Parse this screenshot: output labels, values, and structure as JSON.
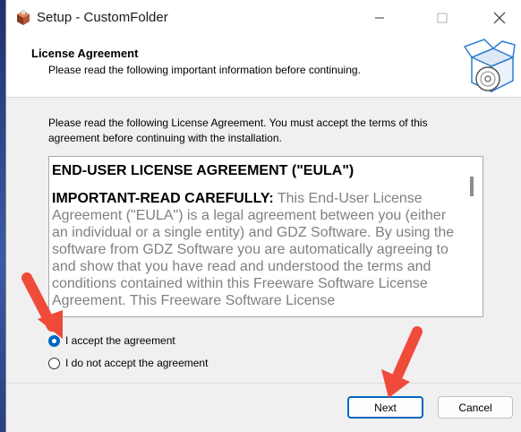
{
  "window": {
    "title": "Setup - CustomFolder"
  },
  "header": {
    "title": "License Agreement",
    "subtitle": "Please read the following important information before continuing."
  },
  "intro": "Please read the following License Agreement. You must accept the terms of this agreement before continuing with the installation.",
  "license": {
    "heading": "END-USER LICENSE AGREEMENT (\"EULA\")",
    "lead": "IMPORTANT-READ CAREFULLY:",
    "body": "This End-User License Agreement (\"EULA\") is a legal agreement between you (either an individual or a single entity) and GDZ Software. By using the software from GDZ Software you are automatically agreeing to and show that you have read and understood the terms and conditions contained within this Freeware Software License Agreement. This Freeware Software License"
  },
  "options": {
    "accept": "I accept the agreement",
    "decline": "I do not accept the agreement",
    "selected": "accept"
  },
  "buttons": {
    "next": "Next",
    "cancel": "Cancel"
  },
  "colors": {
    "accent": "#0067c0",
    "annotation_arrow": "#f04a3a"
  },
  "icons": [
    "setup-app-icon",
    "minimize-icon",
    "maximize-icon",
    "close-icon",
    "software-box-icon"
  ]
}
